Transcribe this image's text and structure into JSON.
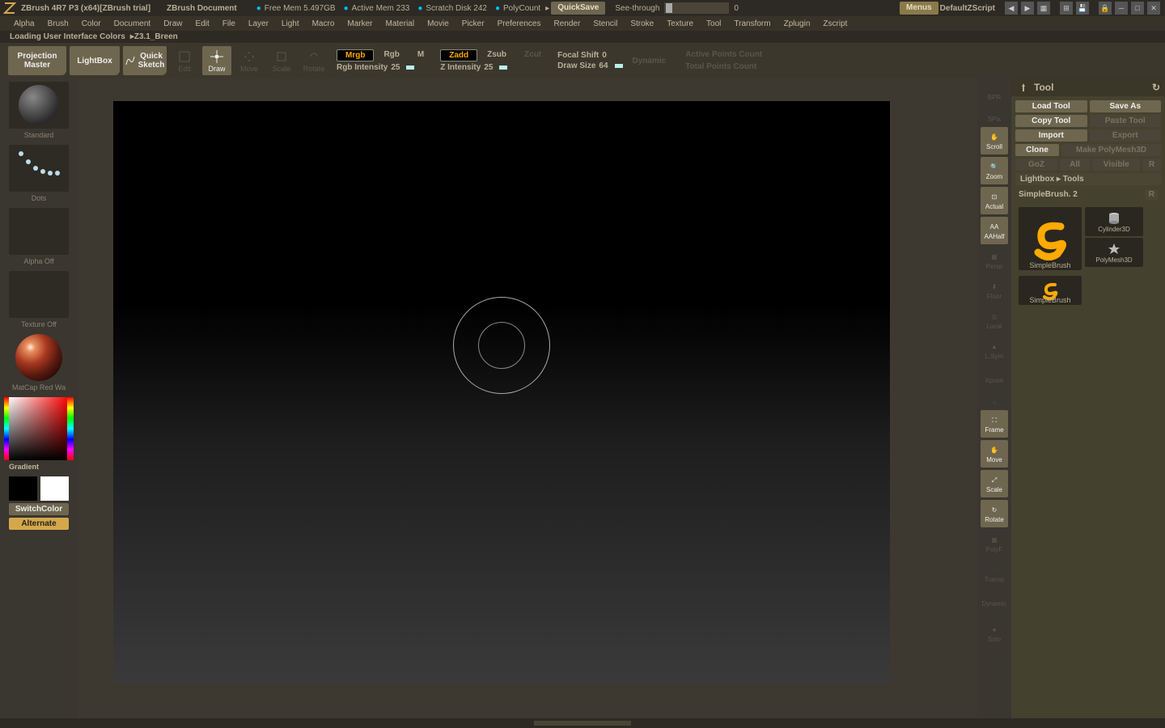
{
  "titlebar": {
    "app": "ZBrush 4R7 P3 (x64)[ZBrush trial]",
    "doc": "ZBrush Document",
    "free_mem": "Free Mem 5.497GB",
    "active_mem": "Active Mem 233",
    "scratch": "Scratch Disk 242",
    "polycount": "PolyCount",
    "quicksave": "QuickSave",
    "seethrough": "See-through",
    "seethrough_val": "0",
    "menus": "Menus",
    "zscript": "DefaultZScript"
  },
  "menus": [
    "Alpha",
    "Brush",
    "Color",
    "Document",
    "Draw",
    "Edit",
    "File",
    "Layer",
    "Light",
    "Macro",
    "Marker",
    "Material",
    "Movie",
    "Picker",
    "Preferences",
    "Render",
    "Stencil",
    "Stroke",
    "Texture",
    "Tool",
    "Transform",
    "Zplugin",
    "Zscript"
  ],
  "status": {
    "text": "Loading User Interface Colors",
    "path": "Z3.1_Breen"
  },
  "tb2": {
    "projection": "Projection Master",
    "lightbox": "LightBox",
    "quicksketch": "Quick Sketch",
    "edit": "Edit",
    "draw": "Draw",
    "move": "Move",
    "scale": "Scale",
    "rotate": "Rotate",
    "mrgb": "Mrgb",
    "rgb": "Rgb",
    "m": "M",
    "rgb_intensity": "Rgb Intensity",
    "rgb_intensity_val": "25",
    "zadd": "Zadd",
    "zsub": "Zsub",
    "zcut": "Zcut",
    "z_intensity": "Z Intensity",
    "z_intensity_val": "25",
    "focal_shift": "Focal Shift",
    "focal_shift_val": "0",
    "draw_size": "Draw Size",
    "draw_size_val": "64",
    "dynamic": "Dynamic",
    "active_pts": "Active Points Count",
    "total_pts": "Total Points Count"
  },
  "left": {
    "standard": "Standard",
    "dots": "Dots",
    "alpha_off": "Alpha Off",
    "texture_off": "Texture Off",
    "matcap": "MatCap Red Wa",
    "gradient": "Gradient",
    "switchcolor": "SwitchColor",
    "alternate": "Alternate"
  },
  "shelf": {
    "bpr": "BPR",
    "spix": "SPix",
    "scroll": "Scroll",
    "zoom": "Zoom",
    "actual": "Actual",
    "aahalf": "AAHalf",
    "persp": "Persp",
    "floor": "Floor",
    "local": "Local",
    "lsym": "L.Sym",
    "xpose": "Xpose",
    "frame": "Frame",
    "move": "Move",
    "scale": "Scale",
    "rotate": "Rotate",
    "polyf": "PolyF",
    "transp": "Transp",
    "dynamic": "Dynamic",
    "solo": "Solo"
  },
  "tool": {
    "header": "Tool",
    "load": "Load Tool",
    "saveas": "Save As",
    "copy": "Copy Tool",
    "paste": "Paste Tool",
    "import": "Import",
    "export": "Export",
    "clone": "Clone",
    "make": "Make PolyMesh3D",
    "goz": "GoZ",
    "all": "All",
    "visible": "Visible",
    "r": "R",
    "lightbox_tools": "Lightbox ▸ Tools",
    "simplebrush_n": "SimpleBrush. 2",
    "simplebrush": "SimpleBrush",
    "cylinder": "Cylinder3D",
    "polymesh": "PolyMesh3D"
  }
}
